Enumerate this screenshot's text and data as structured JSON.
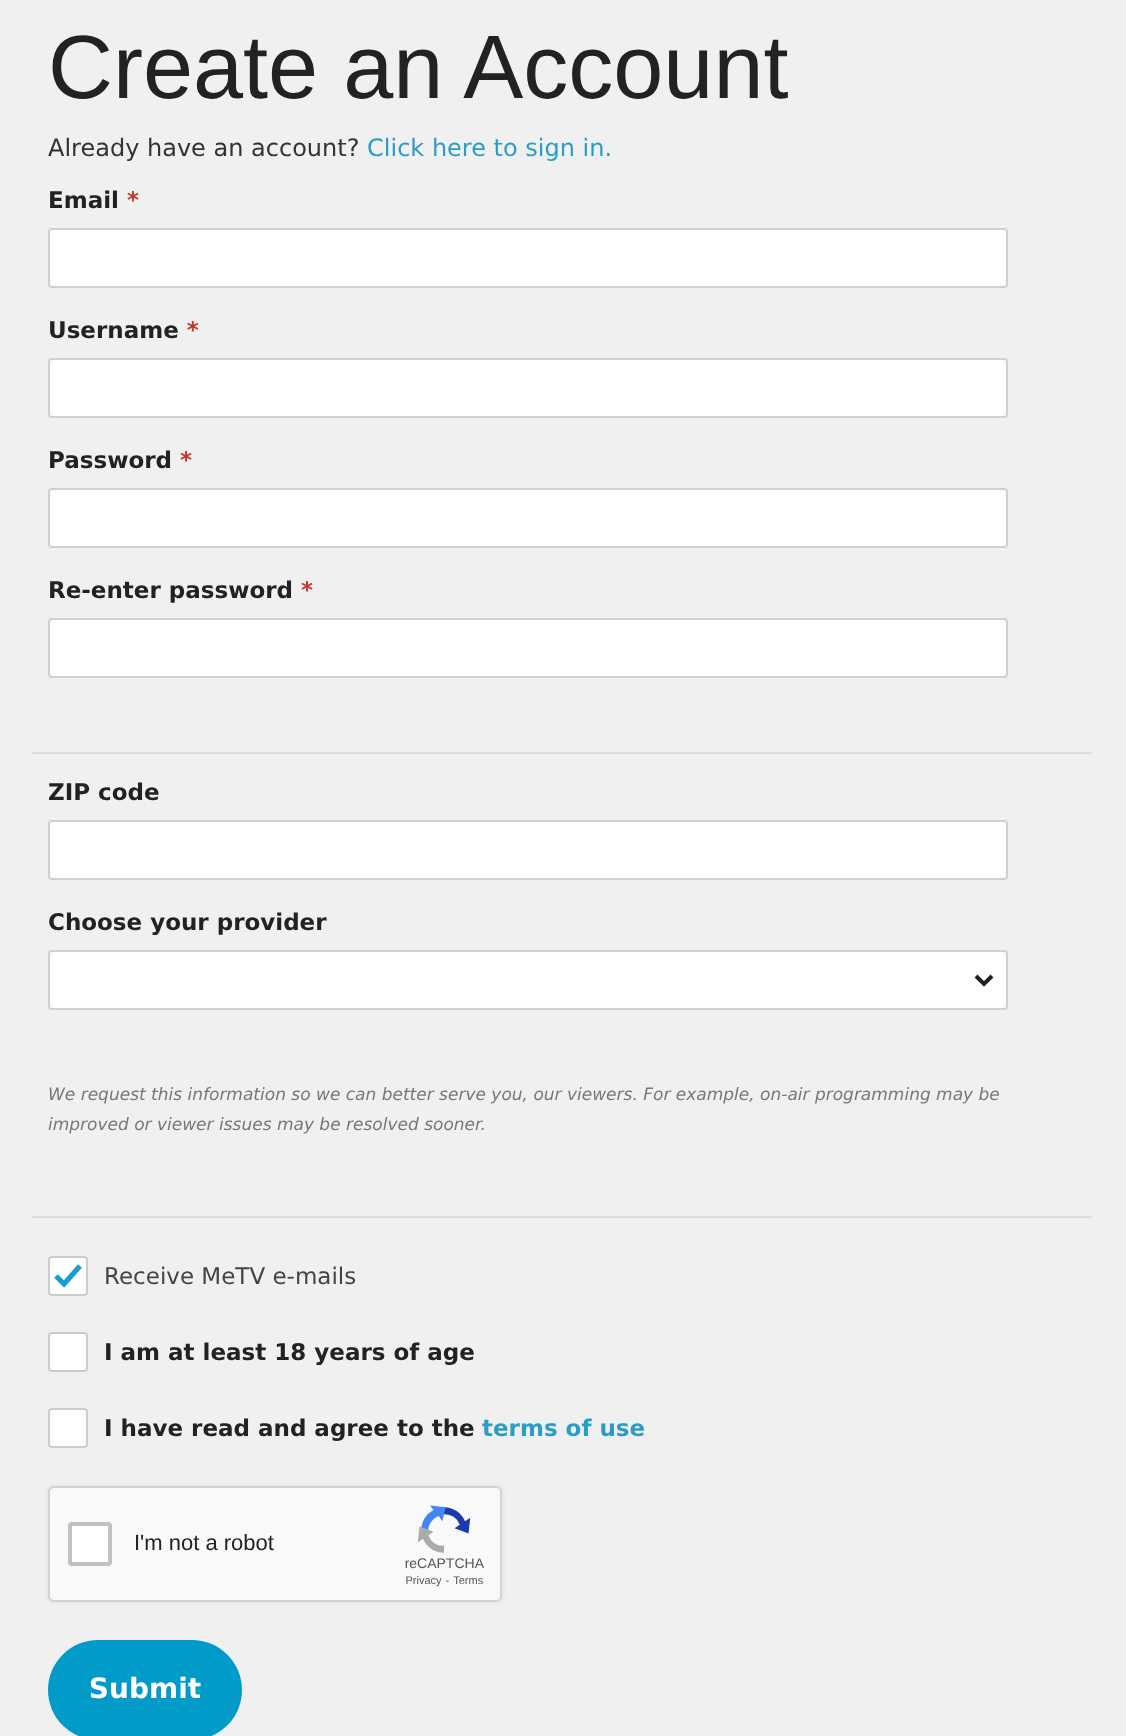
{
  "title": "Create an Account",
  "signin": {
    "text": "Already have an account?",
    "link": "Click here to sign in."
  },
  "sections": [
    {
      "fields": [
        {
          "label": "Email",
          "required_mark": "*",
          "kind": "text"
        },
        {
          "label": "Username",
          "required_mark": "*",
          "kind": "text"
        },
        {
          "label": "Password",
          "required_mark": "*",
          "kind": "text"
        },
        {
          "label": "Re-enter password",
          "required_mark": "*",
          "kind": "text"
        }
      ]
    },
    {
      "fields": [
        {
          "label": "ZIP code",
          "kind": "text"
        },
        {
          "label": "Choose your provider",
          "kind": "select"
        }
      ],
      "note": "We request this information so we can better serve you, our viewers. For example, on-air programming may be improved or viewer issues may be resolved sooner."
    }
  ],
  "checkboxes": [
    {
      "label": "Receive MeTV e-mails",
      "checked": true,
      "kind": "plain"
    },
    {
      "label": "I am at least 18 years of age",
      "checked": false,
      "kind": "bold"
    },
    {
      "label": "I have read and agree to the",
      "link": "terms of use",
      "checked": false,
      "kind": "bold"
    }
  ],
  "captcha": {
    "label": "I'm not a robot",
    "checked": false,
    "brand": "reCAPTCHA",
    "privacy": "Privacy",
    "separator": "-",
    "terms": "Terms"
  },
  "submit": "Submit"
}
